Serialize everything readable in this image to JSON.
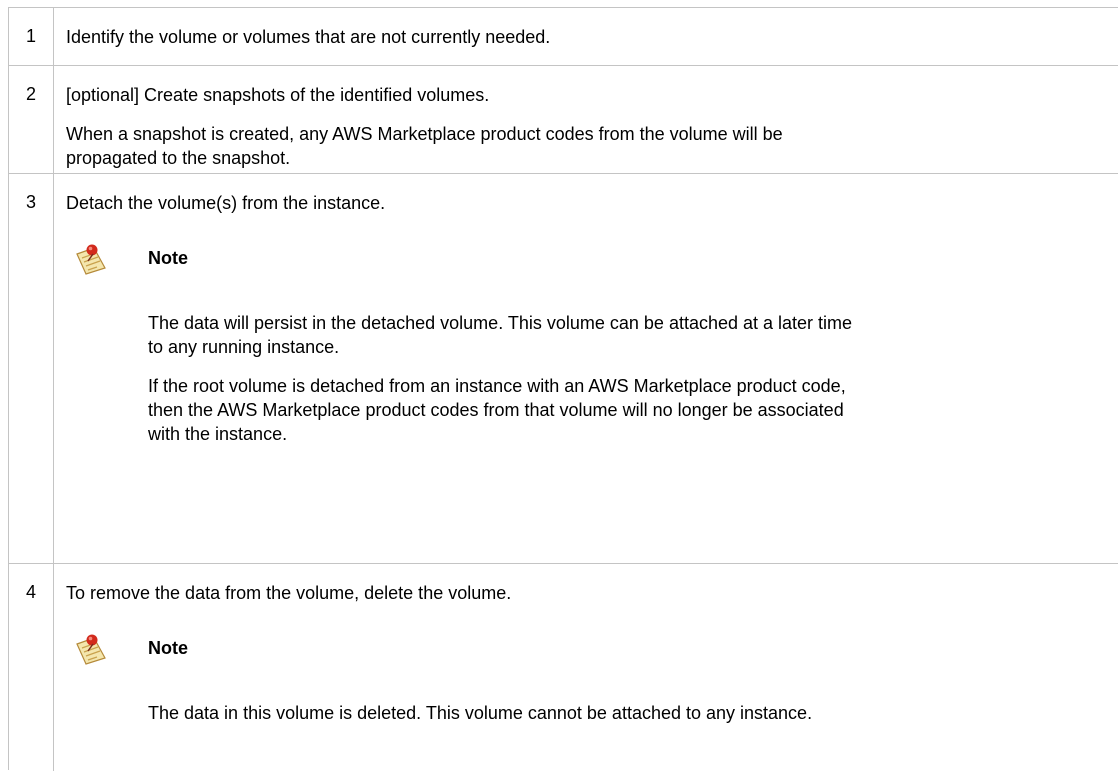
{
  "steps": [
    {
      "number": "1",
      "text": "Identify the volume or volumes that are not currently needed."
    },
    {
      "number": "2",
      "text": "[optional] Create snapshots of the identified volumes.",
      "detail": [
        "When a snapshot is created, any AWS Marketplace product codes from the volume will be",
        "propagated to the snapshot."
      ]
    },
    {
      "number": "3",
      "text": "Detach the volume(s) from the instance.",
      "note": {
        "icon": "note-pushpin-icon",
        "title": "Note",
        "paragraph1": [
          "The data will persist in the detached volume. This volume can be attached at a later time",
          "to any running instance."
        ],
        "paragraph2": [
          "If the root volume is detached from an instance with an AWS Marketplace product code,",
          "then the AWS Marketplace product codes from that volume will no longer be associated",
          "with the instance."
        ]
      }
    },
    {
      "number": "4",
      "text": "To remove the data from the volume, delete the volume.",
      "note": {
        "icon": "note-pushpin-icon",
        "title": "Note",
        "paragraph1": [
          "The data in this volume is deleted. This volume cannot be attached to any instance."
        ]
      }
    }
  ],
  "colors": {
    "border": "#c4c4c4",
    "text": "#000000",
    "note_pin": "#d22a1c",
    "note_paper": "#f3e3a8"
  }
}
